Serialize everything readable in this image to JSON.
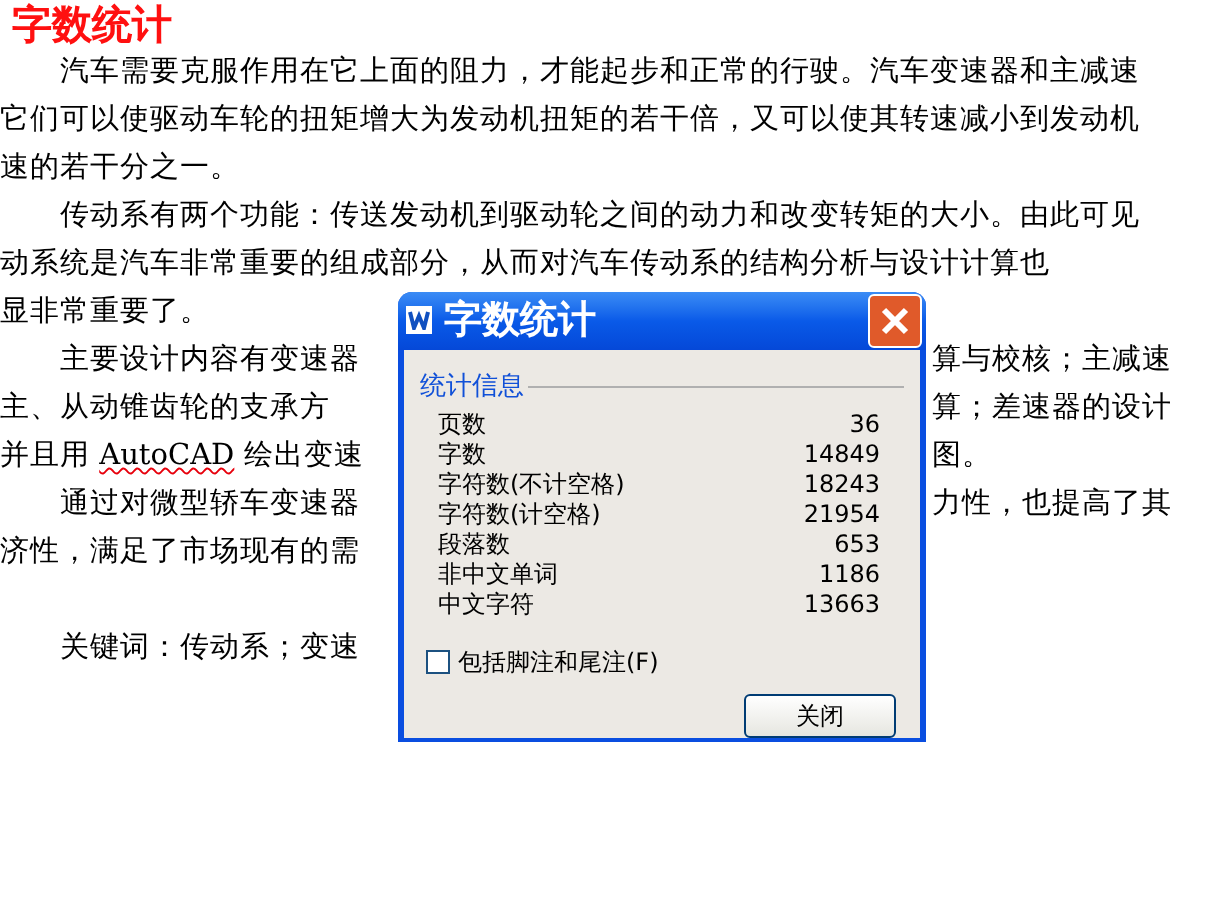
{
  "title_label": "字数统计",
  "document": {
    "lines": [
      {
        "kind": "body",
        "indented": true,
        "segments": [
          {
            "text": "汽车需要克服作用在它上面的阻力，才能起步和正常的行驶。汽车变速器和主减速",
            "misspelled": false
          }
        ]
      },
      {
        "kind": "body",
        "indented": false,
        "segments": [
          {
            "text": "它们可以使驱动车轮的扭矩增大为发动机扭矩的若干倍，又可以使其转速减小到发动机",
            "misspelled": false
          }
        ]
      },
      {
        "kind": "body",
        "indented": false,
        "segments": [
          {
            "text": "速的若干分之一。",
            "misspelled": false
          }
        ]
      },
      {
        "kind": "body",
        "indented": true,
        "segments": [
          {
            "text": "传动系有两个功能：传送发动机到驱动轮之间的动力和改变转矩的大小。由此可见",
            "misspelled": false
          }
        ]
      },
      {
        "kind": "body",
        "indented": false,
        "segments": [
          {
            "text": "动系统是汽车非常重要的组成部分，从而对汽车传动系的结构分析与设计计算也",
            "misspelled": false
          }
        ]
      },
      {
        "kind": "body",
        "indented": false,
        "segments": [
          {
            "text": "显非常重要了。",
            "misspelled": false
          }
        ]
      },
      {
        "kind": "body",
        "indented": true,
        "segments": [
          {
            "text": "主要设计内容有变速器",
            "misspelled": false
          }
        ],
        "right": "算与校核；主减速"
      },
      {
        "kind": "body",
        "indented": false,
        "segments": [
          {
            "text": "主、从动锥齿轮的支承方",
            "misspelled": false
          }
        ],
        "right": "算；差速器的设计"
      },
      {
        "kind": "body",
        "indented": false,
        "segments": [
          {
            "text": "并且用 ",
            "misspelled": false
          },
          {
            "text": "AutoCAD",
            "misspelled": true
          },
          {
            "text": " 绘出变速",
            "misspelled": false
          }
        ],
        "right": "图。"
      },
      {
        "kind": "body",
        "indented": true,
        "segments": [
          {
            "text": "通过对微型轿车变速器",
            "misspelled": false
          }
        ],
        "right": "力性，也提高了其"
      },
      {
        "kind": "body",
        "indented": false,
        "segments": [
          {
            "text": "济性，满足了市场现有的需",
            "misspelled": false
          }
        ]
      },
      {
        "kind": "keywords",
        "indented": true,
        "segments": [
          {
            "text": "关键词：传动系；变速",
            "misspelled": false
          }
        ]
      }
    ]
  },
  "dialog": {
    "title": "字数统计",
    "group_label": "统计信息",
    "stats": [
      {
        "label": "页数",
        "value": "36"
      },
      {
        "label": "字数",
        "value": "14849"
      },
      {
        "label": "字符数(不计空格)",
        "value": "18243"
      },
      {
        "label": "字符数(计空格)",
        "value": "21954"
      },
      {
        "label": "段落数",
        "value": "653"
      },
      {
        "label": "非中文单词",
        "value": "1186"
      },
      {
        "label": "中文字符",
        "value": "13663"
      }
    ],
    "checkbox": {
      "label": "包括脚注和尾注(F)",
      "checked": false
    },
    "button": "关闭"
  }
}
